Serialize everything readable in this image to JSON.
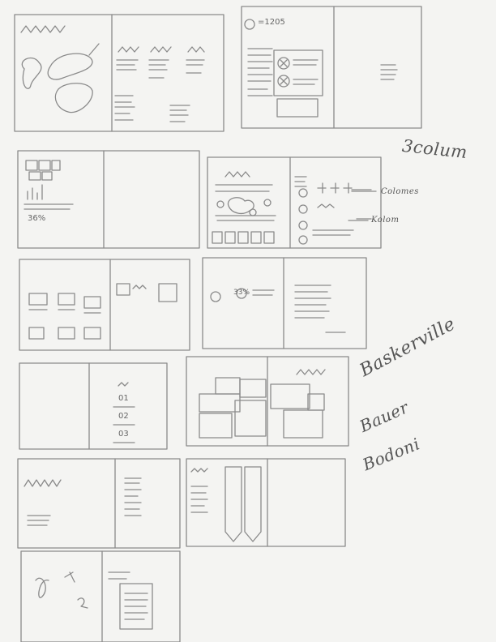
{
  "notes": {
    "three_column": "3colum",
    "kolom_1": "Colomes",
    "kolom_2": "Kolom",
    "font_1": "Baskerville",
    "font_2": "Bauer",
    "font_3": "Bodoni"
  },
  "thumbnails": {
    "t2_header": "=1205",
    "t3_percent": "36%",
    "t8_percent": "33%",
    "t9_num_1": "01",
    "t9_num_2": "02",
    "t9_num_3": "03"
  },
  "ink_color": "#8a8a8a"
}
